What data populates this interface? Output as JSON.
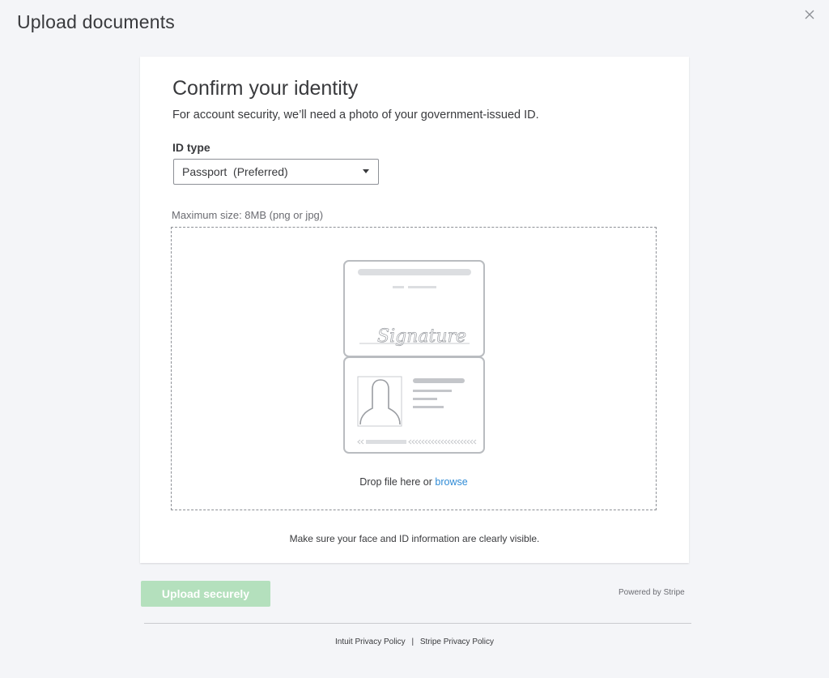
{
  "header": {
    "title": "Upload documents"
  },
  "card": {
    "title": "Confirm your identity",
    "description": "For account security, we’ll need a photo of your government-issued ID.",
    "id_type_label": "ID type",
    "id_type_selected": "Passport  (Preferred)",
    "max_size": "Maximum size: 8MB (png or jpg)",
    "drop_text": "Drop file here or",
    "browse_label": "browse",
    "signature_text": "Signature",
    "hint": "Make sure your face and ID information are clearly visible."
  },
  "actions": {
    "upload_label": "Upload securely",
    "powered_by": "Powered by Stripe"
  },
  "footer": {
    "links": [
      "Intuit Privacy Policy",
      "Stripe Privacy Policy"
    ],
    "separator": "|"
  },
  "icons": {
    "close": "close-icon",
    "caret": "caret-down-icon"
  },
  "colors": {
    "upload_button": "#b4e0bd",
    "link": "#2f8bd6",
    "background": "#f4f5f8"
  }
}
